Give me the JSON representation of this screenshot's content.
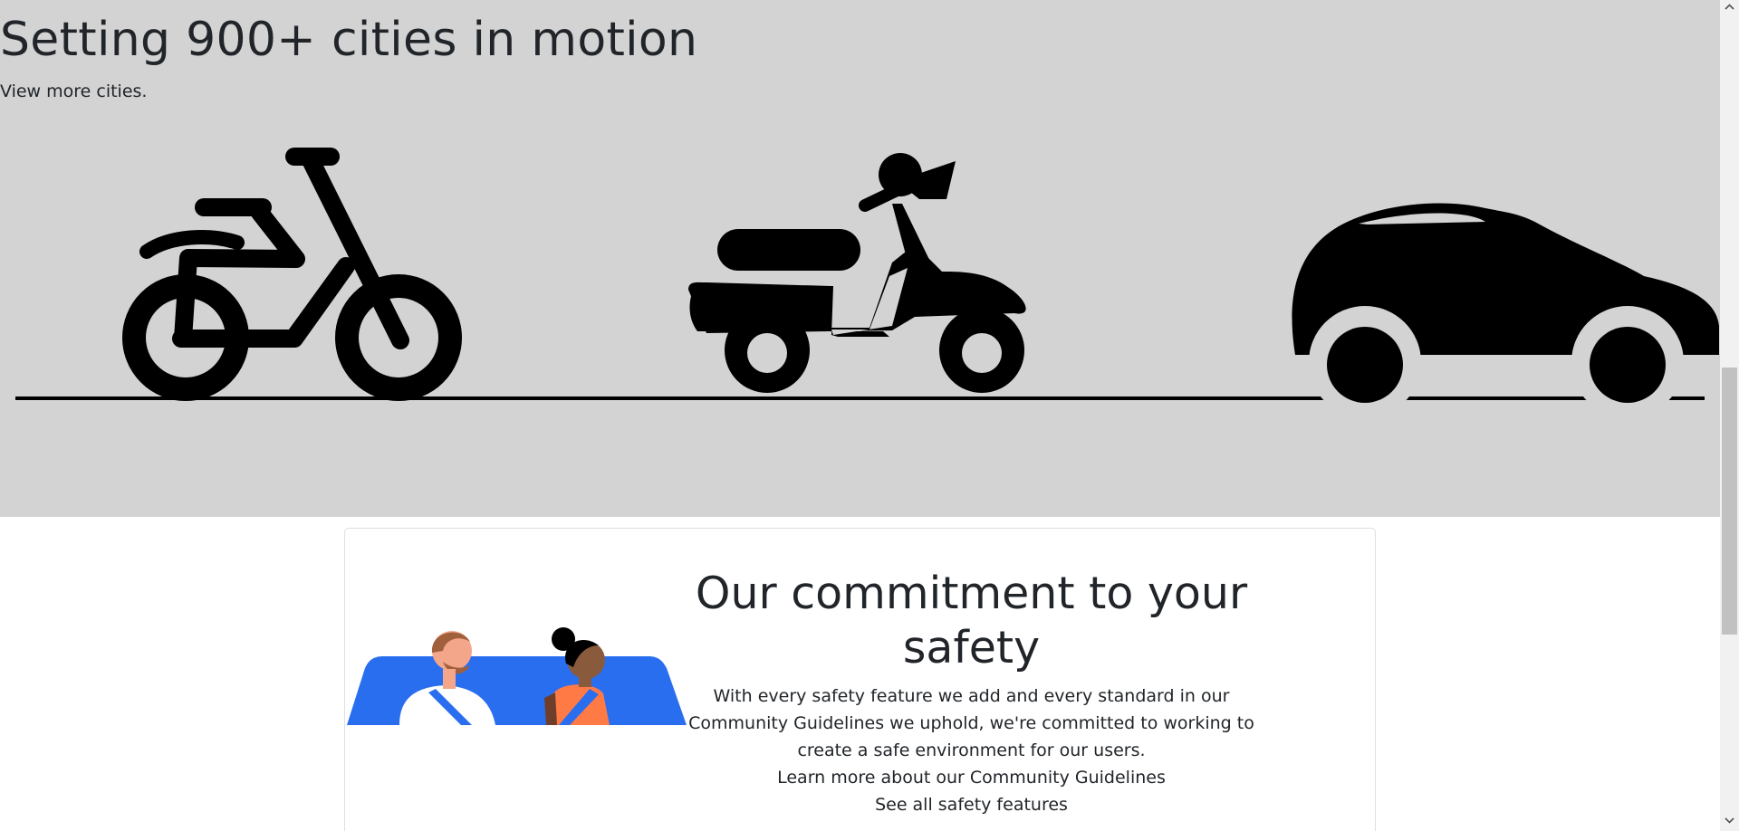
{
  "hero": {
    "title": "Setting 900+ cities in motion",
    "link_text": "View more cities.",
    "background": "#d3d3d3",
    "vehicles": [
      "bike-icon",
      "scooter-icon",
      "car-icon"
    ]
  },
  "safety_card": {
    "title": "Our commitment to your safety",
    "body": "With every safety feature we add and every standard in our Community Guidelines we uphold, we're committed to working to create a safe environment for our users.",
    "link_guidelines": "Learn more about our Community Guidelines",
    "link_features": "See all safety features",
    "illustration": "rider-and-driver-illustration",
    "colors": {
      "car_blue": "#2a6ef0",
      "passenger_orange": "#ff7a45"
    }
  }
}
